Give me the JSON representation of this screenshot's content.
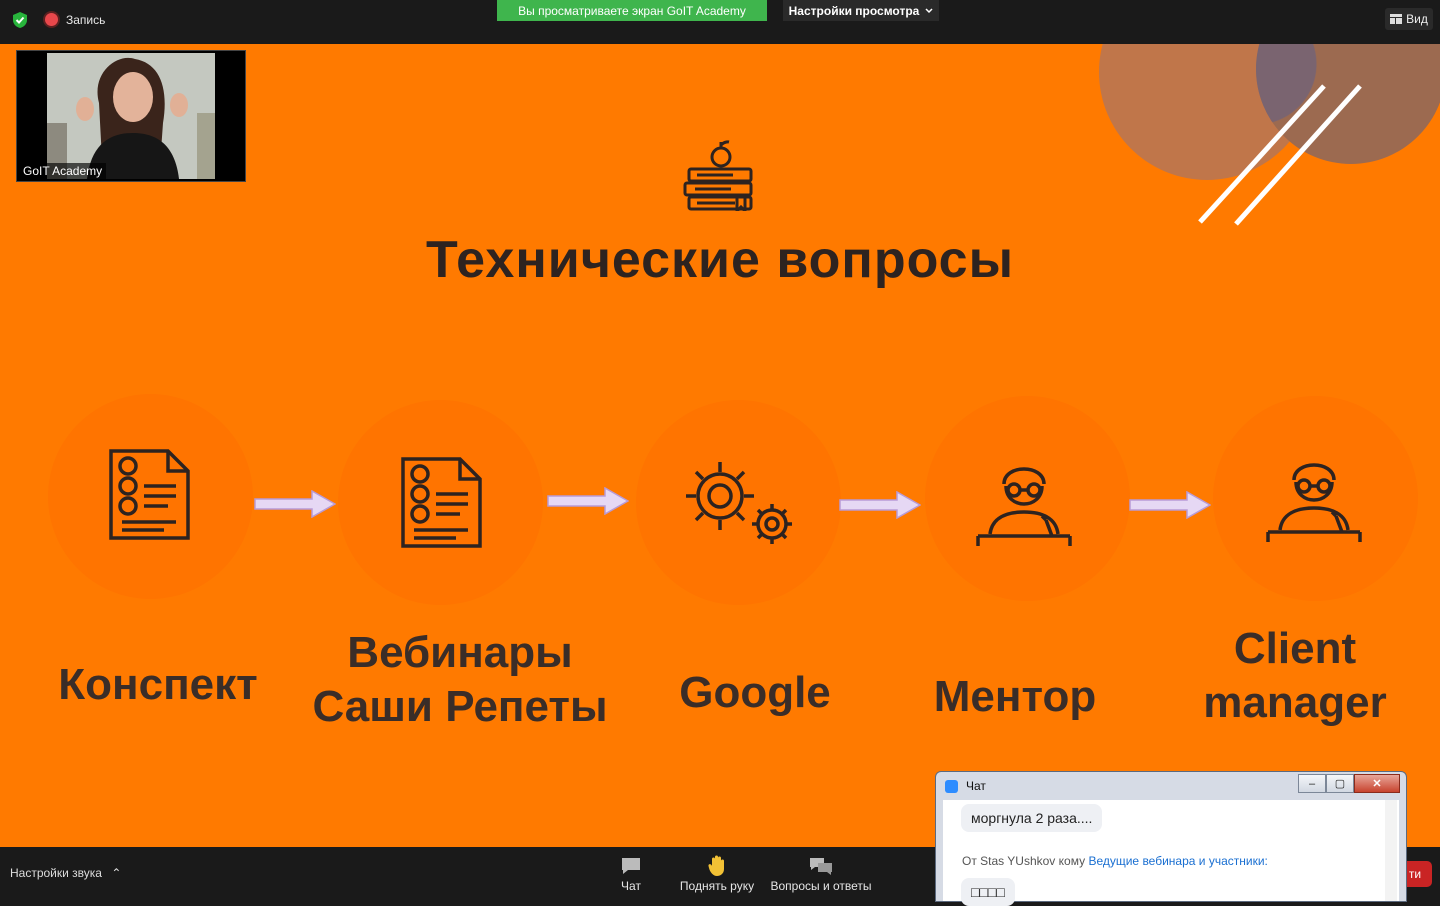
{
  "topbar": {
    "recording_label": "Запись",
    "share_banner": "Вы просматриваете экран GoIT Academy",
    "view_settings": "Настройки просмотра",
    "view_button": "Вид"
  },
  "slide": {
    "title": "Технические вопросы",
    "steps": [
      {
        "line1": "Конспект",
        "line2": ""
      },
      {
        "line1": "Вебинары",
        "line2": "Саши Репеты"
      },
      {
        "line1": "Google",
        "line2": ""
      },
      {
        "line1": "Ментор",
        "line2": ""
      },
      {
        "line1": "Client",
        "line2": "manager"
      }
    ]
  },
  "video": {
    "participant_name": "GoIT Academy"
  },
  "bottombar": {
    "audio_settings": "Настройки звука",
    "chat": "Чат",
    "raise_hand": "Поднять руку",
    "qa": "Вопросы и ответы",
    "end_partial": "ти"
  },
  "chat": {
    "title": "Чат",
    "messages": [
      {
        "text": "моргнула 2 раза...."
      },
      {
        "from_prefix": "От Stas YUshkov кому",
        "to": "Ведущие вебинара и участники:",
        "text": "□□□□"
      }
    ]
  },
  "colors": {
    "slide_bg": "#ff7a00",
    "banner_green": "#3fb54d",
    "arrow_fill": "#e6d8f4"
  }
}
